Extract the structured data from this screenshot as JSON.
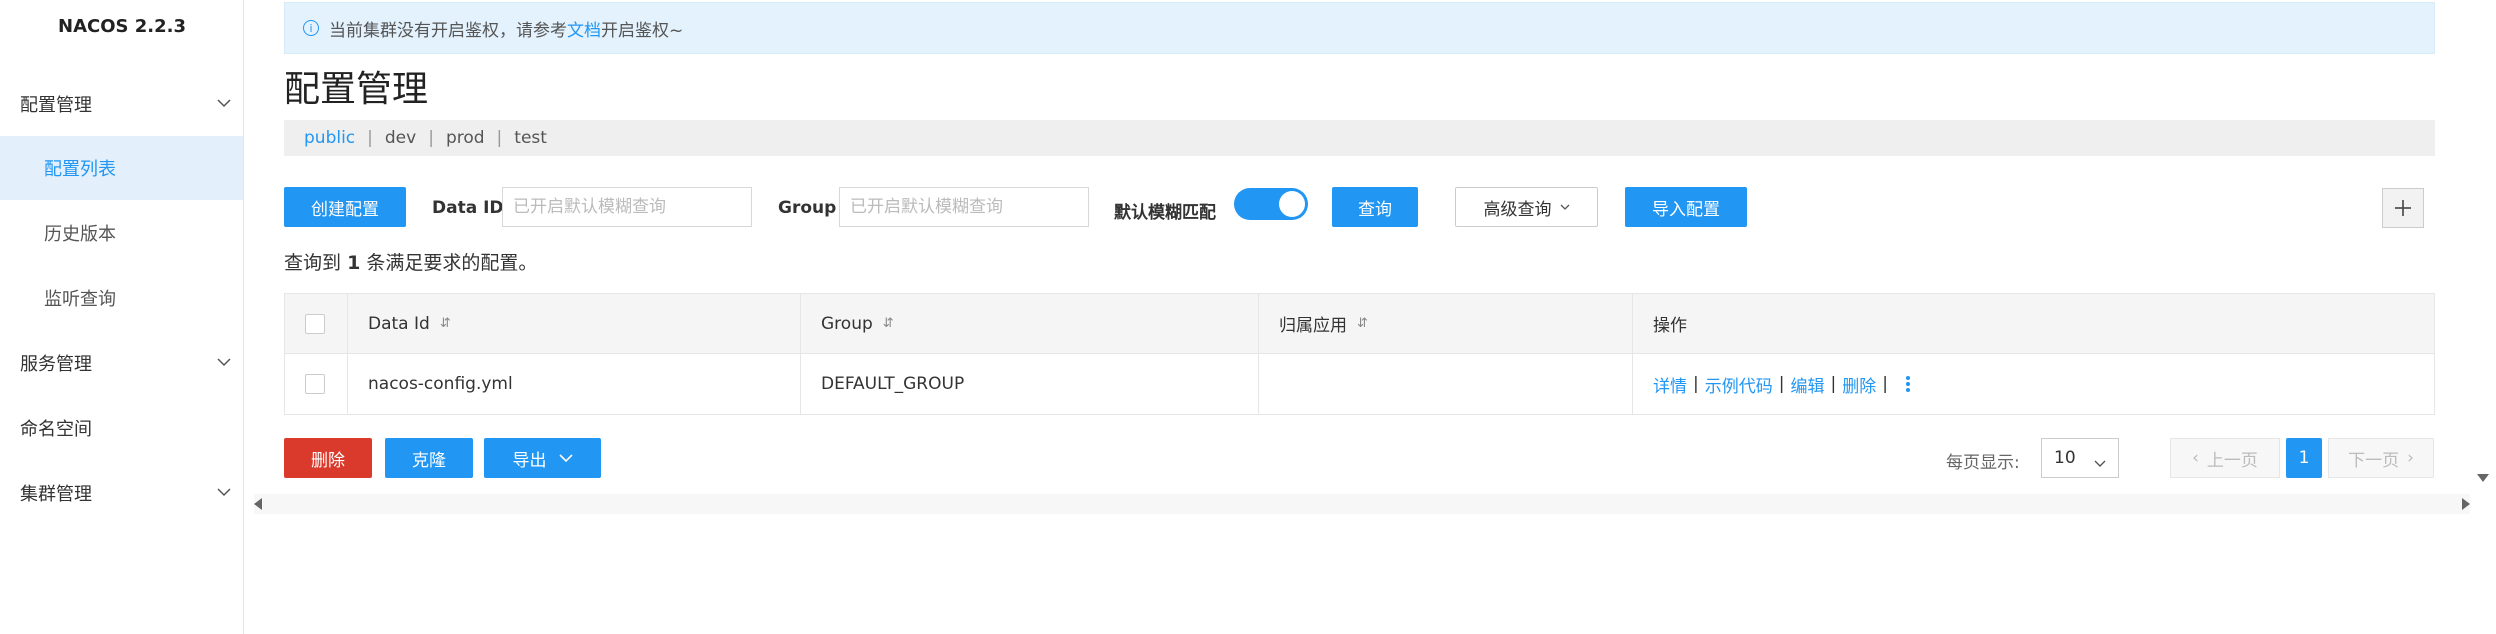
{
  "app": {
    "title": "NACOS 2.2.3"
  },
  "sidebar": {
    "items": [
      {
        "label": "配置管理",
        "type": "group",
        "expanded": true
      },
      {
        "label": "配置列表",
        "type": "sub",
        "active": true
      },
      {
        "label": "历史版本",
        "type": "sub"
      },
      {
        "label": "监听查询",
        "type": "sub"
      },
      {
        "label": "服务管理",
        "type": "group"
      },
      {
        "label": "命名空间",
        "type": "plain"
      },
      {
        "label": "集群管理",
        "type": "group"
      }
    ]
  },
  "notice": {
    "text_before": "当前集群没有开启鉴权，请参考",
    "link": "文档",
    "text_after": "开启鉴权~"
  },
  "page": {
    "title": "配置管理"
  },
  "namespaces": {
    "items": [
      "public",
      "dev",
      "prod",
      "test"
    ],
    "active": "public"
  },
  "toolbar": {
    "create_label": "创建配置",
    "dataid_label": "Data ID",
    "dataid_placeholder": "已开启默认模糊查询",
    "group_label": "Group",
    "group_placeholder": "已开启默认模糊查询",
    "fuzzy_label": "默认模糊匹配",
    "fuzzy_on": true,
    "query_label": "查询",
    "advanced_label": "高级查询",
    "import_label": "导入配置"
  },
  "result": {
    "prefix": "查询到",
    "count": "1",
    "suffix": "条满足要求的配置。"
  },
  "table": {
    "columns": [
      "Data Id",
      "Group",
      "归属应用",
      "操作"
    ],
    "sort_icon": "⇵",
    "rows": [
      {
        "data_id": "nacos-config.yml",
        "group": "DEFAULT_GROUP",
        "app": ""
      }
    ],
    "actions": [
      "详情",
      "示例代码",
      "编辑",
      "删除"
    ]
  },
  "bottom": {
    "delete_label": "删除",
    "clone_label": "克隆",
    "export_label": "导出"
  },
  "pagination": {
    "page_size_label": "每页显示:",
    "page_size": "10",
    "prev_label": "上一页",
    "next_label": "下一页",
    "current_page": "1"
  },
  "colors": {
    "primary": "#2196f3",
    "danger": "#d93a2b",
    "notice_bg": "#e3f2fd"
  }
}
